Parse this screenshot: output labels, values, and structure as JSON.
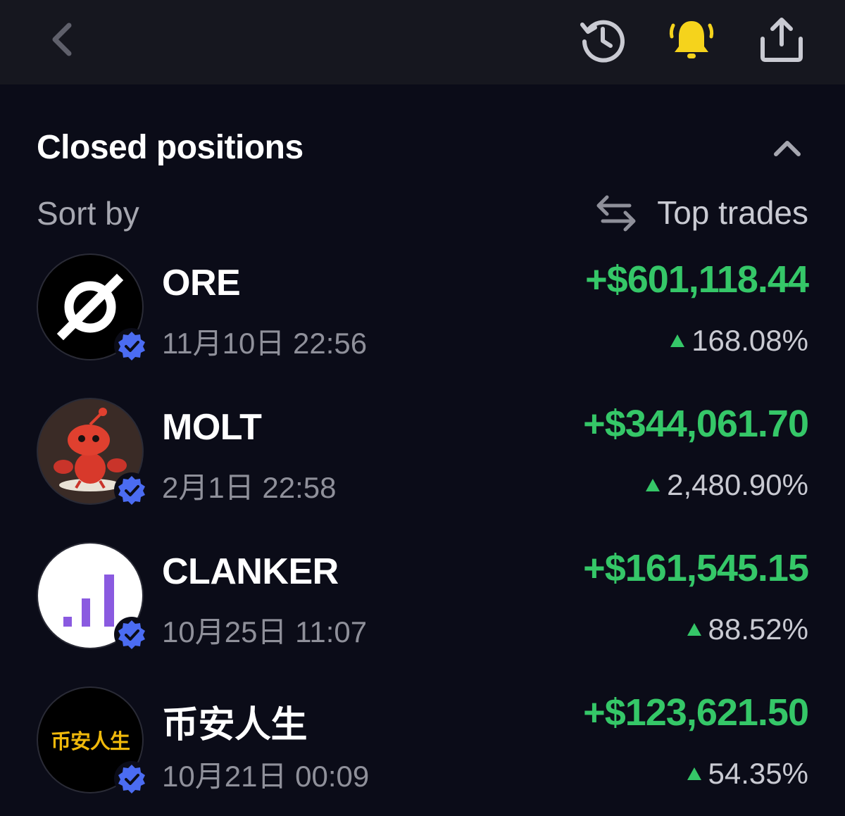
{
  "section": {
    "title": "Closed positions",
    "sort_label": "Sort by",
    "sort_value": "Top trades"
  },
  "icons": {
    "back": "chevron-left-icon",
    "history": "history-icon",
    "alerts": "bell-icon",
    "share": "share-icon",
    "collapse": "chevron-up-icon",
    "sort": "swap-arrows-icon",
    "verified": "verified-badge-icon"
  },
  "colors": {
    "background": "#0b0c18",
    "topbar": "#16171f",
    "profit_green": "#35c768",
    "bell_yellow": "#f5d31c",
    "verified_blue": "#4b6cf2"
  },
  "positions": [
    {
      "name": "ORE",
      "time": "11月10日 22:56",
      "pnl": "+$601,118.44",
      "pct": "168.08%"
    },
    {
      "name": "MOLT",
      "time": "2月1日 22:58",
      "pnl": "+$344,061.70",
      "pct": "2,480.90%"
    },
    {
      "name": "CLANKER",
      "time": "10月25日 11:07",
      "pnl": "+$161,545.15",
      "pct": "88.52%"
    },
    {
      "name": "币安人生",
      "time": "10月21日 00:09",
      "pnl": "+$123,621.50",
      "pct": "54.35%",
      "logo_text": "币安人生"
    }
  ]
}
